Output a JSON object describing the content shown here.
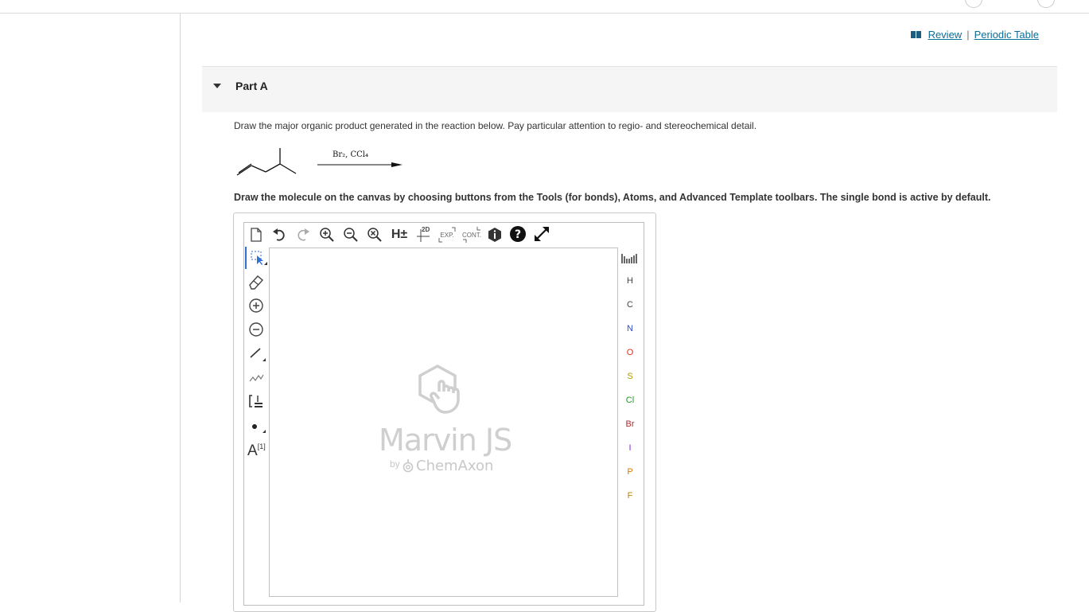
{
  "header": {
    "review_label": "Review",
    "separator": "|",
    "periodic_label": "Periodic Table"
  },
  "part": {
    "title": "Part A"
  },
  "question": {
    "prompt": "Draw the major organic product generated in the reaction below. Pay particular attention to regio- and stereochemical detail.",
    "reagent": "Br₂, CCl₄",
    "instructions": "Draw the molecule on the canvas by choosing buttons from the Tools (for bonds), Atoms, and Advanced Template toolbars. The single bond is active by default."
  },
  "top_toolbar": {
    "items": [
      {
        "icon": "new-document-icon"
      },
      {
        "icon": "undo-icon"
      },
      {
        "icon": "redo-icon"
      },
      {
        "icon": "zoom-in-icon"
      },
      {
        "icon": "zoom-out-icon"
      },
      {
        "icon": "zoom-reset-icon"
      },
      {
        "icon": "hydrogens-icon",
        "text": "H±"
      },
      {
        "icon": "clean-2d-icon",
        "text": "2D"
      },
      {
        "icon": "expand-icon",
        "text": "EXP."
      },
      {
        "icon": "contract-icon",
        "text": "CONT."
      },
      {
        "icon": "info-icon"
      },
      {
        "icon": "help-icon"
      },
      {
        "icon": "fullscreen-icon"
      }
    ]
  },
  "left_toolbar": {
    "items": [
      {
        "icon": "select-icon"
      },
      {
        "icon": "eraser-icon"
      },
      {
        "icon": "charge-plus-icon"
      },
      {
        "icon": "charge-minus-icon"
      },
      {
        "icon": "single-bond-icon"
      },
      {
        "icon": "chain-icon"
      },
      {
        "icon": "bracket-icon"
      },
      {
        "icon": "radical-icon"
      },
      {
        "icon": "atom-map-icon",
        "text": "A",
        "superscript": "[1]"
      }
    ]
  },
  "atoms": [
    {
      "symbol": "H",
      "color": "#444444"
    },
    {
      "symbol": "C",
      "color": "#444444"
    },
    {
      "symbol": "N",
      "color": "#3050c8"
    },
    {
      "symbol": "O",
      "color": "#e0301e"
    },
    {
      "symbol": "S",
      "color": "#b09a00"
    },
    {
      "symbol": "Cl",
      "color": "#1f9a1f"
    },
    {
      "symbol": "Br",
      "color": "#a52a2a"
    },
    {
      "symbol": "I",
      "color": "#8a2be2"
    },
    {
      "symbol": "P",
      "color": "#e07b00"
    },
    {
      "symbol": "F",
      "color": "#b8860b"
    }
  ],
  "watermark": {
    "title": "Marvin JS",
    "by": "by",
    "company": "ChemAxon"
  }
}
